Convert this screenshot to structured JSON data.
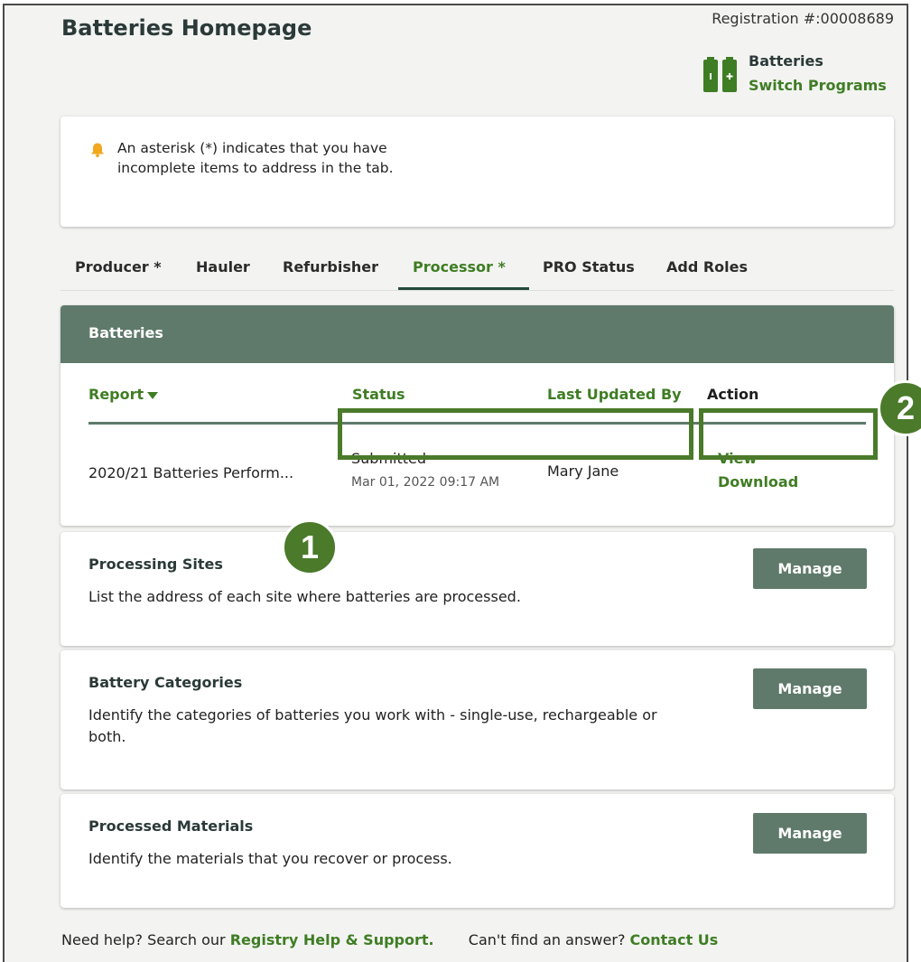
{
  "header": {
    "title": "Batteries Homepage",
    "registration": "Registration #:00008689",
    "program_icon": "batteries-icon",
    "program_name": "Batteries",
    "switch_label": "Switch Programs"
  },
  "notice": {
    "icon": "bell-icon",
    "text": "An asterisk (*) indicates that you have incomplete items to address in the tab."
  },
  "tabs": [
    {
      "label": "Producer *"
    },
    {
      "label": "Hauler"
    },
    {
      "label": "Refurbisher"
    },
    {
      "label": "Processor *",
      "active": true
    },
    {
      "label": "PRO Status"
    },
    {
      "label": "Add Roles"
    }
  ],
  "batteries_table": {
    "title": "Batteries",
    "columns": {
      "report": "Report",
      "status": "Status",
      "updated_by": "Last Updated By",
      "action": "Action"
    },
    "row": {
      "report": "2020/21 Batteries Perform...",
      "status": "Submitted",
      "date": "Mar 01, 2022 09:17 AM",
      "updated_by": "Mary Jane",
      "view": "View",
      "download": "Download"
    }
  },
  "markers": [
    "1",
    "2"
  ],
  "sections": [
    {
      "title": "Processing Sites",
      "desc": "List the address of each site where batteries are processed.",
      "button": "Manage"
    },
    {
      "title": "Battery Categories",
      "desc": "Identify the categories of batteries you work with - single-use, rechargeable or both.",
      "button": "Manage"
    },
    {
      "title": "Processed Materials",
      "desc": "Identify the materials that you recover or process.",
      "button": "Manage"
    }
  ],
  "footer": {
    "help_text": "Need help? Search our",
    "help_link": "Registry Help & Support.",
    "contact_text": "Can't find an answer?",
    "contact_link": "Contact Us"
  },
  "colors": {
    "accent_green": "#3f7d24",
    "header_green": "#5f7a6b",
    "highlight_green": "#4a7a2a",
    "bell": "#f2a81d"
  }
}
